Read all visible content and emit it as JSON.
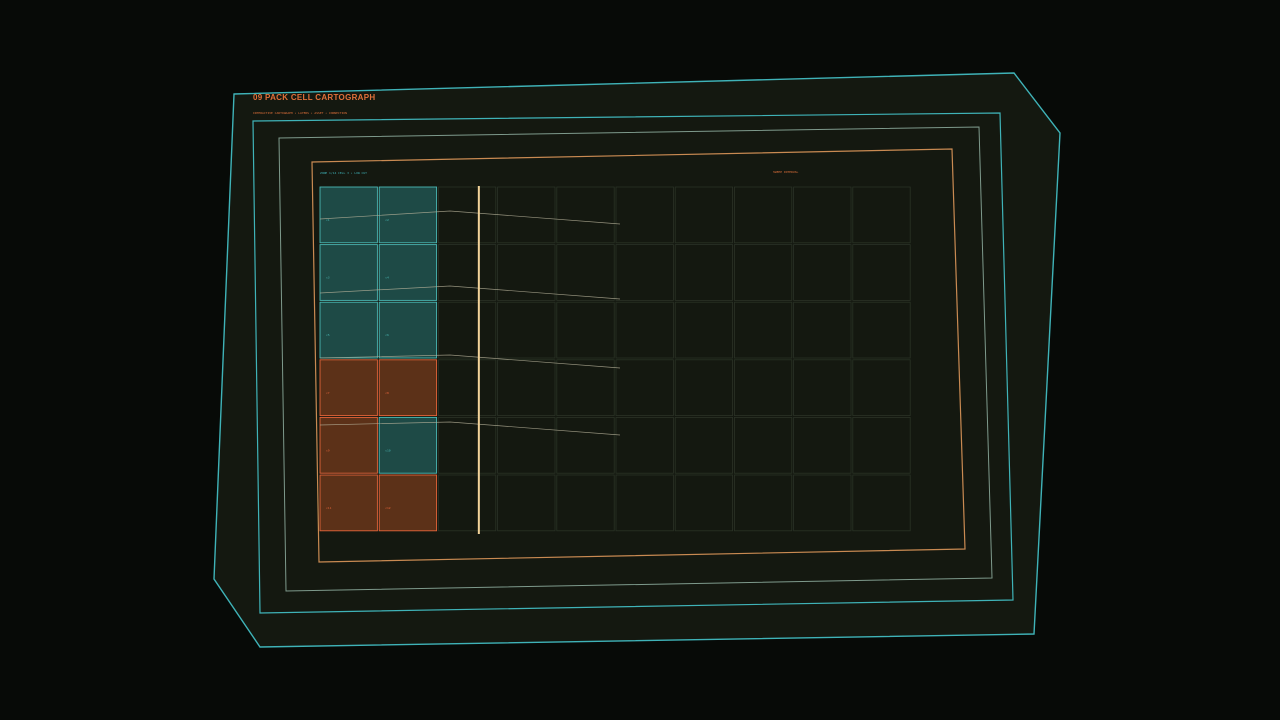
{
  "header": {
    "title": "09  PACK CELL CARTOGRAPH",
    "subtitle": "INTERACTIVE CARTOGRAPH • LAYERS • ASSET • CONNECTION"
  },
  "panel": {
    "status_left": "ZONE 1/14  CELL 3 • LOW CUT",
    "status_right": "SWEEP INTERVAL"
  },
  "grid": {
    "rows": 6,
    "cols": 10,
    "states": [
      [
        "ok",
        "ok",
        "empty",
        "empty",
        "empty",
        "empty",
        "empty",
        "empty",
        "empty",
        "empty"
      ],
      [
        "ok",
        "ok",
        "empty",
        "empty",
        "empty",
        "empty",
        "empty",
        "empty",
        "empty",
        "empty"
      ],
      [
        "ok",
        "ok",
        "empty",
        "empty",
        "empty",
        "empty",
        "empty",
        "empty",
        "empty",
        "empty"
      ],
      [
        "warn",
        "warn",
        "empty",
        "empty",
        "empty",
        "empty",
        "empty",
        "empty",
        "empty",
        "empty"
      ],
      [
        "warn",
        "ok",
        "empty",
        "empty",
        "empty",
        "empty",
        "empty",
        "empty",
        "empty",
        "empty"
      ],
      [
        "warn",
        "warn",
        "empty",
        "empty",
        "empty",
        "empty",
        "empty",
        "empty",
        "empty",
        "empty"
      ]
    ],
    "cell_labels": [
      [
        "c1",
        "c2"
      ],
      [
        "c3",
        "c4"
      ],
      [
        "c5",
        "c6"
      ],
      [
        "c7",
        "c8"
      ],
      [
        "c9",
        "c10"
      ],
      [
        "c11",
        "c12"
      ]
    ]
  },
  "sweep": {
    "position_fraction": 0.27
  },
  "colors": {
    "background": "#070a07",
    "frame_fill": "#141810",
    "cyan": "#3fb3b8",
    "sage": "#7e9a8c",
    "orange": "#e0703a",
    "amber": "#c98a52",
    "sweep": "#f4d49a",
    "cell_ok_fill": "#1e4a46",
    "cell_ok_stroke": "#4ab8b5",
    "cell_warn_fill": "#5c3118",
    "cell_warn_stroke": "#e4643a",
    "cell_empty_stroke": "#2a3226"
  }
}
